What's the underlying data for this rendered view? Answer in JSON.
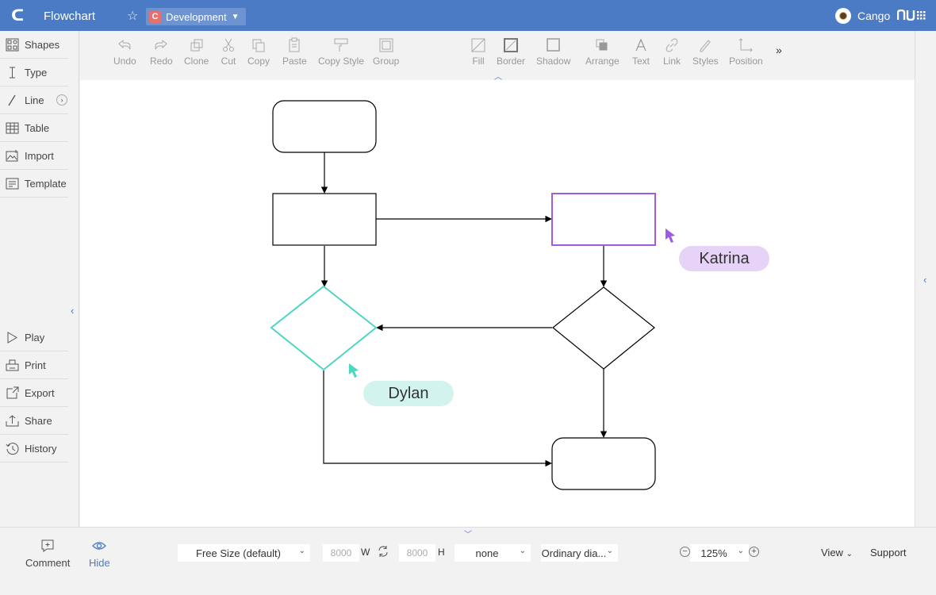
{
  "header": {
    "title": "Flowchart",
    "folder_badge": "C",
    "folder_name": "Development",
    "user_name": "Cango",
    "brand": "nu∷"
  },
  "sidebar": {
    "items": [
      {
        "label": "Shapes",
        "icon": "shapes-icon"
      },
      {
        "label": "Type",
        "icon": "type-icon"
      },
      {
        "label": "Line",
        "icon": "line-icon"
      },
      {
        "label": "Table",
        "icon": "table-icon"
      },
      {
        "label": "Import",
        "icon": "image-icon"
      },
      {
        "label": "Template",
        "icon": "template-icon"
      }
    ],
    "bottom_items": [
      {
        "label": "Play",
        "icon": "play-icon"
      },
      {
        "label": "Print",
        "icon": "print-icon"
      },
      {
        "label": "Export",
        "icon": "export-icon"
      },
      {
        "label": "Share",
        "icon": "share-icon"
      },
      {
        "label": "History",
        "icon": "history-icon"
      }
    ]
  },
  "toolbar": {
    "edit": [
      "Undo",
      "Redo",
      "Clone",
      "Cut",
      "Copy",
      "Paste",
      "Copy Style",
      "Group"
    ],
    "format": [
      "Fill",
      "Border",
      "Shadow",
      "Arrange",
      "Text",
      "Link",
      "Styles",
      "Position"
    ],
    "more": "»"
  },
  "collaborators": [
    {
      "name": "Katrina",
      "color": "#a05ce0",
      "bg": "#e6d3f7"
    },
    {
      "name": "Dylan",
      "color": "#4dd6c0",
      "bg": "#d3f4ee"
    }
  ],
  "bottom": {
    "comment_label": "Comment",
    "hide_label": "Hide",
    "page_size": "Free Size (default)",
    "width": "8000",
    "width_unit": "W",
    "height": "8000",
    "height_unit": "H",
    "background": "none",
    "diagram_type": "Ordinary dia...",
    "zoom": "125%",
    "view_label": "View",
    "support_label": "Support"
  },
  "colors": {
    "accent": "#4a7bc4",
    "katrina": "#a05ce0",
    "dylan": "#4dd6c0"
  }
}
